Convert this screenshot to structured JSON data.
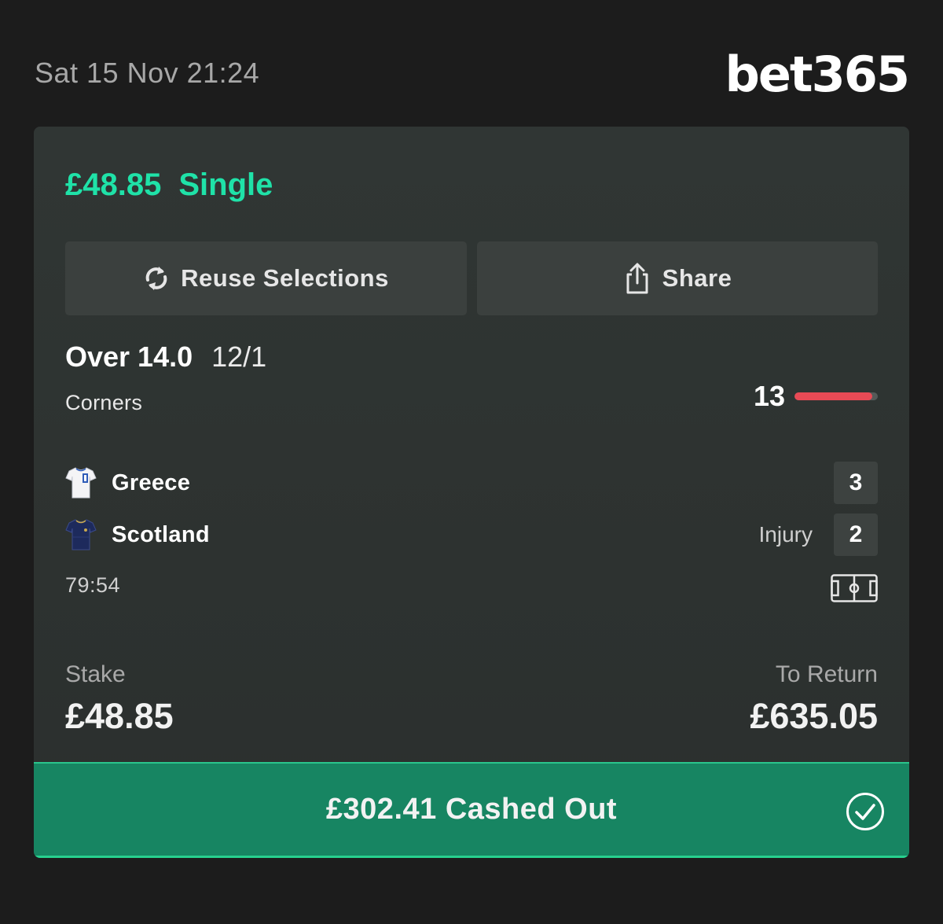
{
  "header": {
    "datetime": "Sat 15 Nov 21:24",
    "brand": "bet365"
  },
  "bet": {
    "amount": "£48.85",
    "type": "Single",
    "accent_color": "#1fe2a8"
  },
  "actions": {
    "reuse_label": "Reuse Selections",
    "reuse_icon": "refresh-icon",
    "share_label": "Share",
    "share_icon": "share-icon"
  },
  "selection": {
    "name": "Over 14.0",
    "odds": "12/1",
    "market": "Corners",
    "progress_count": "13",
    "progress_fraction": 0.93,
    "progress_color": "#e84a55"
  },
  "match": {
    "home": {
      "name": "Greece",
      "score": "3",
      "kit_icon": "greece-kit-icon"
    },
    "away": {
      "name": "Scotland",
      "score": "2",
      "status": "Injury",
      "kit_icon": "scotland-kit-icon"
    },
    "clock": "79:54",
    "pitch_icon": "pitch-icon"
  },
  "summary": {
    "stake_label": "Stake",
    "stake_value": "£48.85",
    "return_label": "To Return",
    "return_value": "£635.05"
  },
  "cashout": {
    "text": "£302.41 Cashed Out",
    "icon": "check-circle-icon",
    "color": "#178562"
  }
}
